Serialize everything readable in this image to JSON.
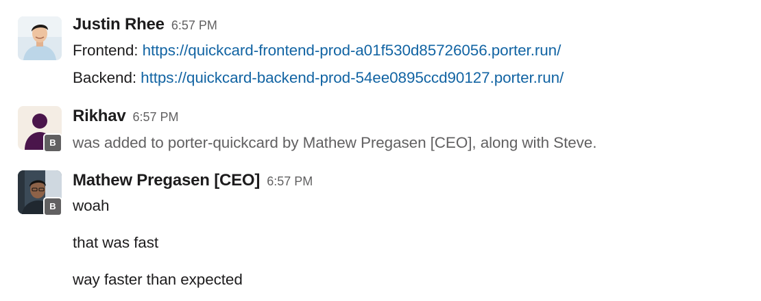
{
  "messages": [
    {
      "sender": "Justin Rhee",
      "time": "6:57 PM",
      "lines": [
        {
          "label": "Frontend: ",
          "link": "https://quickcard-frontend-prod-a01f530d85726056.porter.run/"
        },
        {
          "label": "Backend: ",
          "link": "https://quickcard-backend-prod-54ee0895ccd90127.porter.run/"
        }
      ]
    },
    {
      "sender": "Rikhav",
      "time": "6:57 PM",
      "badge": "B",
      "system_text": "was added to porter-quickcard by Mathew Pregasen [CEO], along with Steve."
    },
    {
      "sender": "Mathew Pregasen [CEO]",
      "time": "6:57 PM",
      "badge": "B",
      "lines": [
        "woah",
        "that was fast",
        "way faster than expected"
      ]
    }
  ],
  "colors": {
    "link": "#1264a3",
    "text": "#1d1c1d",
    "muted": "#616061",
    "rikhav_avatar": "#4a154b",
    "badge": "#616061"
  },
  "icons": {
    "justin_avatar": "user-photo-avatar",
    "rikhav_avatar": "person-silhouette-icon",
    "mathew_avatar": "user-photo-avatar",
    "badge": "bot-badge-icon"
  }
}
